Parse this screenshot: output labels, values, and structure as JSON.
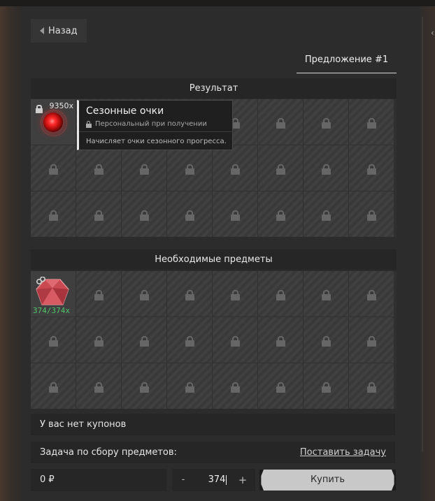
{
  "header": {
    "back_label": "Назад",
    "tab_label": "Предложение #1"
  },
  "result": {
    "title": "Результат",
    "item": {
      "icon": "seasonal-points-orb",
      "quantity": "9350x"
    }
  },
  "tooltip": {
    "title": "Сезонные очки",
    "subtitle": "Персональный при получении",
    "description": "Начисляет очки сезонного прогресса."
  },
  "required": {
    "title": "Необходимые предметы",
    "item": {
      "icon": "red-crystal-gem",
      "quantity": "374/374x"
    }
  },
  "coupons": {
    "text": "У вас нет купонов"
  },
  "task": {
    "label": "Задача по сбору предметов:",
    "link": "Поставить задачу"
  },
  "footer": {
    "price": "0 ₽",
    "minus": "-",
    "quantity": "374",
    "plus": "+",
    "buy_label": "Купить"
  },
  "colors": {
    "quantity_green": "#4fc66a",
    "buy_button": "#c8c8c8"
  }
}
